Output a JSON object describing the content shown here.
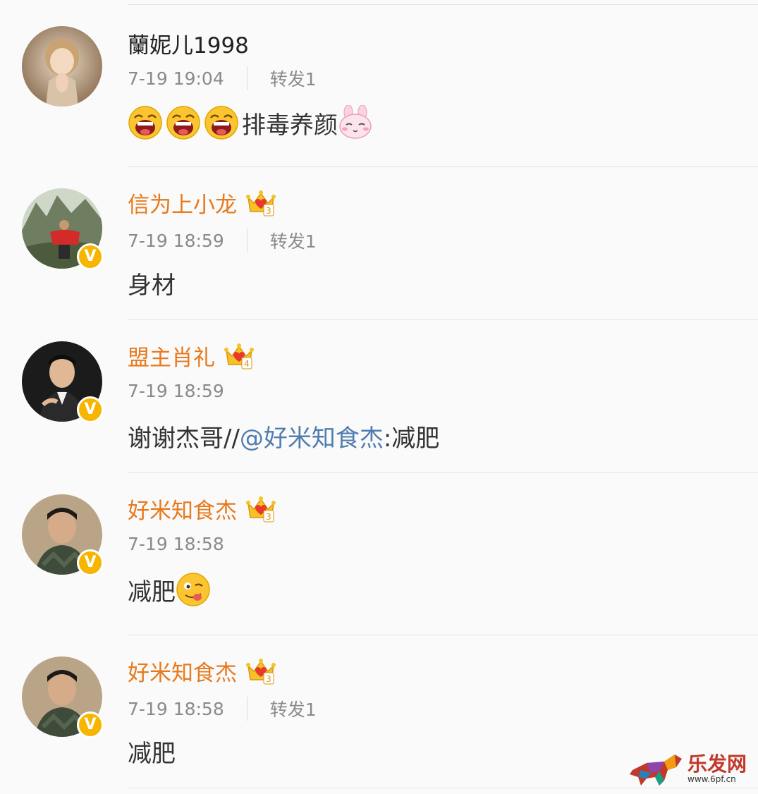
{
  "comments": [
    {
      "username": "蘭妮儿1998",
      "vip": false,
      "verified": false,
      "time": "7-19 19:04",
      "repost": "转发1",
      "text_parts": [
        {
          "kind": "emoji",
          "icon": "grin-emoji"
        },
        {
          "kind": "emoji",
          "icon": "grin-emoji"
        },
        {
          "kind": "emoji",
          "icon": "grin-emoji"
        },
        {
          "kind": "text",
          "value": "排毒养颜"
        },
        {
          "kind": "emoji",
          "icon": "bunny-emoji"
        }
      ]
    },
    {
      "username": "信为上小龙",
      "vip": true,
      "verified": true,
      "time": "7-19 18:59",
      "repost": "转发1",
      "text_parts": [
        {
          "kind": "text",
          "value": "身材"
        }
      ]
    },
    {
      "username": "盟主肖礼",
      "vip": true,
      "verified": true,
      "time": "7-19 18:59",
      "repost": "",
      "text_parts": [
        {
          "kind": "text",
          "value": "谢谢杰哥//"
        },
        {
          "kind": "mention",
          "value": "@好米知食杰"
        },
        {
          "kind": "text",
          "value": ":减肥"
        }
      ]
    },
    {
      "username": "好米知食杰",
      "vip": true,
      "verified": true,
      "time": "7-19 18:58",
      "repost": "",
      "text_parts": [
        {
          "kind": "text",
          "value": "减肥"
        },
        {
          "kind": "emoji",
          "icon": "tongue-emoji"
        }
      ]
    },
    {
      "username": "好米知食杰",
      "vip": true,
      "verified": true,
      "time": "7-19 18:58",
      "repost": "转发1",
      "text_parts": [
        {
          "kind": "text",
          "value": "减肥"
        }
      ]
    }
  ],
  "watermark": {
    "logo": "乐发网",
    "url": "www.6pf.cn"
  },
  "colors": {
    "vip_name": "#e8791d",
    "mention": "#507daf",
    "verified_badge": "#f7b500"
  }
}
